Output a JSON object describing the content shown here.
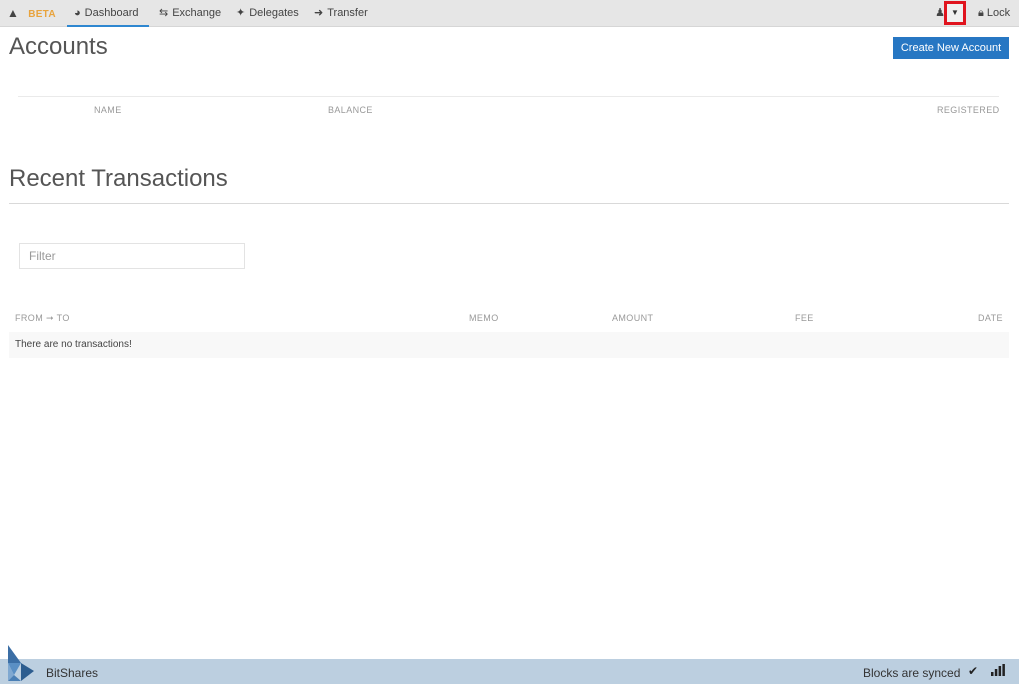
{
  "navbar": {
    "beta_icon": "warning-icon",
    "beta_label": "BETA",
    "tabs": [
      {
        "label": "Dashboard",
        "icon": "dashboard-icon"
      },
      {
        "label": "Exchange",
        "icon": "exchange-arrows-icon"
      },
      {
        "label": "Delegates",
        "icon": "gavel-icon"
      },
      {
        "label": "Transfer",
        "icon": "transfer-icon"
      }
    ],
    "account_icon": "user-icon",
    "dropdown_icon": "caret-down-icon",
    "lock_label": "Lock",
    "lock_icon": "lock-icon"
  },
  "accounts": {
    "title": "Accounts",
    "create_button": "Create New Account",
    "columns": [
      "NAME",
      "BALANCE",
      "REGISTERED"
    ]
  },
  "transactions": {
    "title": "Recent Transactions",
    "filter_placeholder": "Filter",
    "columns": [
      "FROM ➞ TO",
      "MEMO",
      "AMOUNT",
      "FEE",
      "DATE"
    ],
    "empty_message": "There are no transactions!"
  },
  "footer": {
    "brand": "BitShares",
    "status": "Blocks are synced",
    "status_icon": "check-icon",
    "signal_icon": "signal-bars-icon"
  },
  "colors": {
    "accent": "#2777c3",
    "beta": "#e8a33d",
    "footer_bg": "#bccfe0",
    "highlight": "#e0141e"
  }
}
